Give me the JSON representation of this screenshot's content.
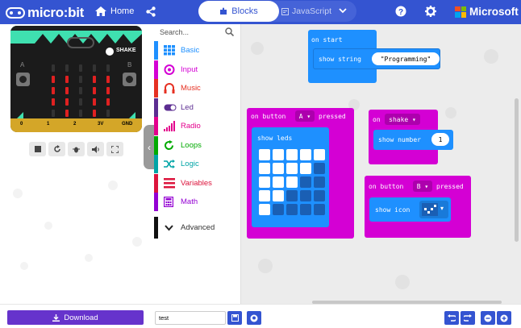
{
  "header": {
    "logo_text": "micro:bit",
    "home_label": "Home",
    "blocks_label": "Blocks",
    "javascript_label": "JavaScript",
    "brand_label": "Microsoft"
  },
  "simulator": {
    "shake_label": "SHAKE",
    "btn_a_label": "A",
    "btn_b_label": "B",
    "pins": [
      "0",
      "1",
      "2",
      "3V",
      "GND"
    ],
    "led_matrix": [
      [
        0,
        0,
        0,
        0,
        0
      ],
      [
        1,
        1,
        0,
        1,
        1
      ],
      [
        1,
        1,
        0,
        1,
        1
      ],
      [
        1,
        1,
        0,
        1,
        1
      ],
      [
        0,
        1,
        0,
        1,
        0
      ]
    ],
    "controls": [
      "stop-icon",
      "restart-icon",
      "debug-icon",
      "mute-icon",
      "fullscreen-icon"
    ]
  },
  "toolbox": {
    "search_placeholder": "Search...",
    "categories": [
      {
        "label": "Basic",
        "color": "#1e90ff",
        "icon": "grid-icon"
      },
      {
        "label": "Input",
        "color": "#d400d4",
        "icon": "target-icon"
      },
      {
        "label": "Music",
        "color": "#e63022",
        "icon": "headphones-icon"
      },
      {
        "label": "Led",
        "color": "#5c2d91",
        "icon": "toggle-icon"
      },
      {
        "label": "Radio",
        "color": "#e3008c",
        "icon": "signal-icon"
      },
      {
        "label": "Loops",
        "color": "#00aa00",
        "icon": "refresh-icon"
      },
      {
        "label": "Logic",
        "color": "#00a4a6",
        "icon": "shuffle-icon"
      },
      {
        "label": "Variables",
        "color": "#dc143c",
        "icon": "lines-icon"
      },
      {
        "label": "Math",
        "color": "#9400d3",
        "icon": "calculator-icon"
      }
    ],
    "advanced_label": "Advanced"
  },
  "workspace": {
    "on_start": {
      "label": "on start",
      "show_string": "show string",
      "string_value": "\"Programming\"",
      "color": "#1e90ff"
    },
    "on_button_a": {
      "label": "on button",
      "button": "A",
      "pressed": "pressed",
      "show_leds": "show leds",
      "color": "#d400d4",
      "leds": [
        [
          1,
          1,
          1,
          1,
          1
        ],
        [
          1,
          1,
          1,
          1,
          0
        ],
        [
          1,
          1,
          1,
          0,
          0
        ],
        [
          1,
          1,
          0,
          0,
          0
        ],
        [
          1,
          0,
          0,
          0,
          0
        ]
      ]
    },
    "on_shake": {
      "label": "on",
      "event": "shake",
      "show_number": "show number",
      "number_value": "1",
      "color": "#d400d4"
    },
    "on_button_b": {
      "label": "on button",
      "button": "B",
      "pressed": "pressed",
      "show_icon": "show icon",
      "color": "#d400d4"
    }
  },
  "bottom": {
    "download_label": "Download",
    "project_name": "test"
  },
  "colors": {
    "header_bg": "#3454d1",
    "download_bg": "#6633cc",
    "basic_block": "#1e90ff",
    "input_block": "#d400d4"
  }
}
